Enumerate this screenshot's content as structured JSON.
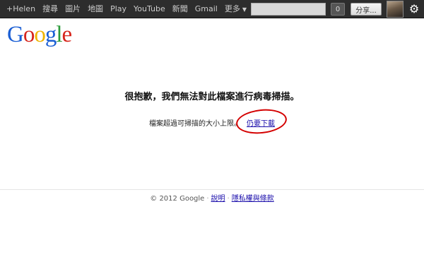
{
  "topbar": {
    "nav": [
      {
        "label": "+Helen",
        "active": false
      },
      {
        "label": "搜尋",
        "active": false
      },
      {
        "label": "圖片",
        "active": false
      },
      {
        "label": "地圖",
        "active": false
      },
      {
        "label": "Play",
        "active": false
      },
      {
        "label": "YouTube",
        "active": false
      },
      {
        "label": "新聞",
        "active": false
      },
      {
        "label": "Gmail",
        "active": false
      },
      {
        "label": "更多",
        "active": false
      }
    ],
    "notification_count": "0",
    "share_label": "分享...",
    "gear_icon": "gear-icon"
  },
  "logo": {
    "letters": [
      "G",
      "o",
      "o",
      "g",
      "l",
      "e"
    ],
    "colors": [
      "#1a5ed4",
      "#d6251c",
      "#f0b400",
      "#1a5ed4",
      "#2b9b3a",
      "#d6251c"
    ]
  },
  "main": {
    "headline": "很抱歉，我們無法對此檔案進行病毒掃描。",
    "subline": "檔案超過可掃描的大小上限。",
    "download_link": "仍要下載",
    "highlight_color": "#d40000"
  },
  "footer": {
    "copyright": "© 2012 Google",
    "help_link": "說明",
    "privacy_link": "隱私權與條款"
  }
}
